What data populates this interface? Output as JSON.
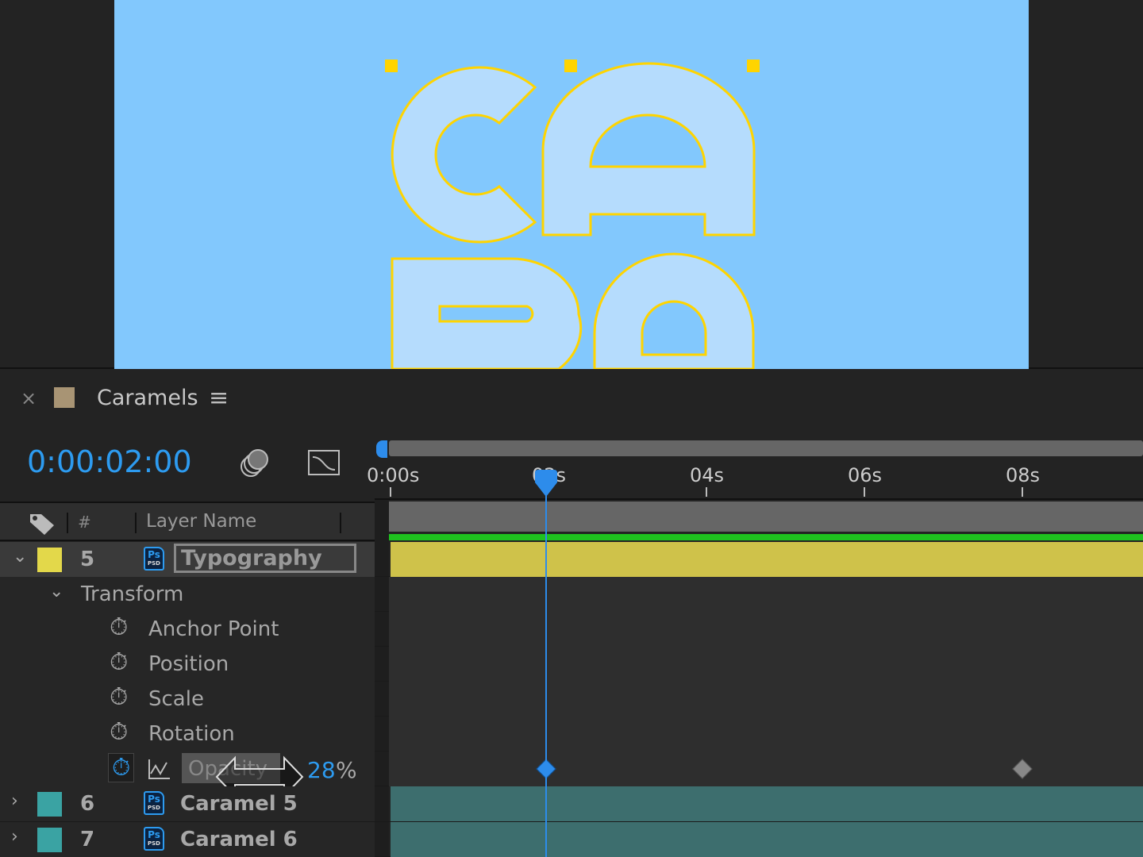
{
  "canvas": {
    "artwork_text": [
      "C",
      "A",
      "R",
      "A"
    ],
    "background": "#82c8fd",
    "stroke": "#ffd400"
  },
  "panel": {
    "title": "Caramels",
    "close": "×",
    "menu": "≡",
    "color": "#a89474"
  },
  "timecode": "0:00:02:00",
  "columns": {
    "label_icon": "tag-icon",
    "number": "#",
    "layer_name": "Layer Name"
  },
  "ruler": {
    "ticks": [
      "0:00s",
      "02s",
      "04s",
      "06s",
      "08s"
    ],
    "current_time_s": 2,
    "accent": "#2d8ceb"
  },
  "layers": [
    {
      "number": "5",
      "name": "Typography",
      "color": "#e3d84a",
      "expanded": true,
      "selected": true
    },
    {
      "number": "6",
      "name": "Caramel 5",
      "color": "#3aa3a3",
      "expanded": false
    },
    {
      "number": "7",
      "name": "Caramel 6",
      "color": "#3aa3a3",
      "expanded": false
    }
  ],
  "transform": {
    "label": "Transform",
    "properties": [
      "Anchor Point",
      "Position",
      "Scale",
      "Rotation"
    ],
    "opacity": {
      "label": "Opacity",
      "value": "28",
      "unit": "%",
      "keyframes_s": [
        2,
        8
      ]
    }
  }
}
